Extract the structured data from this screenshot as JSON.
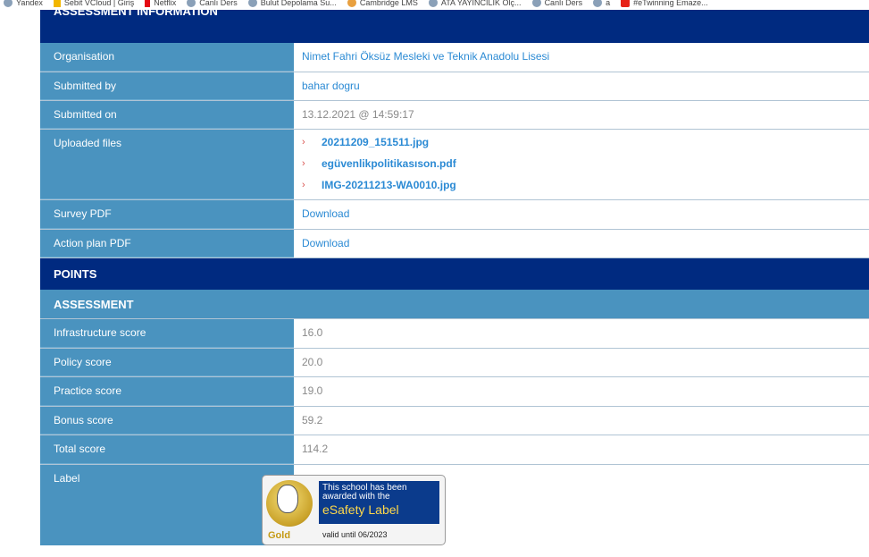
{
  "bookmarks": [
    {
      "label": "Yandex",
      "icon": "globe-icon"
    },
    {
      "label": "Sebit VCloud | Giriş",
      "icon": "v-logo-icon"
    },
    {
      "label": "Netflix",
      "icon": "netflix-icon"
    },
    {
      "label": "Canlı Ders",
      "icon": "globe-icon"
    },
    {
      "label": "Bulut Depolama Su...",
      "icon": "cloud-icon"
    },
    {
      "label": "Cambridge LMS",
      "icon": "cambridge-icon"
    },
    {
      "label": "ATA YAYINCILIK Ölç...",
      "icon": "globe-icon"
    },
    {
      "label": "Canlı Ders",
      "icon": "globe-icon"
    },
    {
      "label": "a",
      "icon": "people-icon"
    },
    {
      "label": "#eTwinning Emaze...",
      "icon": "youtube-icon"
    }
  ],
  "assessment_info": {
    "header": "ASSESSMENT INFORMATION",
    "organisation_label": "Organisation",
    "organisation_value": "Nimet Fahri Öksüz Mesleki ve Teknik Anadolu Lisesi",
    "submitted_by_label": "Submitted by",
    "submitted_by_value": "bahar dogru",
    "submitted_on_label": "Submitted on",
    "submitted_on_value": "13.12.2021 @ 14:59:17",
    "uploaded_files_label": "Uploaded files",
    "files": [
      "20211209_151511.jpg",
      "egüvenlikpolitikasıson.pdf",
      "IMG-20211213-WA0010.jpg"
    ],
    "survey_pdf_label": "Survey PDF",
    "survey_pdf_value": "Download",
    "action_plan_label": "Action plan PDF",
    "action_plan_value": "Download"
  },
  "points": {
    "header": "POINTS",
    "subheader": "ASSESSMENT",
    "infrastructure_label": "Infrastructure score",
    "infrastructure_value": "16.0",
    "policy_label": "Policy score",
    "policy_value": "20.0",
    "practice_label": "Practice score",
    "practice_value": "19.0",
    "bonus_label": "Bonus score",
    "bonus_value": "59.2",
    "total_label": "Total score",
    "total_value": "114.2",
    "label_label": "Label"
  },
  "badge": {
    "line1": "This school has been awarded with the",
    "title": "eSafety Label",
    "level": "Gold",
    "valid": "valid until 06/2023"
  },
  "colors": {
    "dark_header": "#002a80",
    "label_blue": "#4a93bf",
    "link_blue": "#2b8ad4"
  }
}
